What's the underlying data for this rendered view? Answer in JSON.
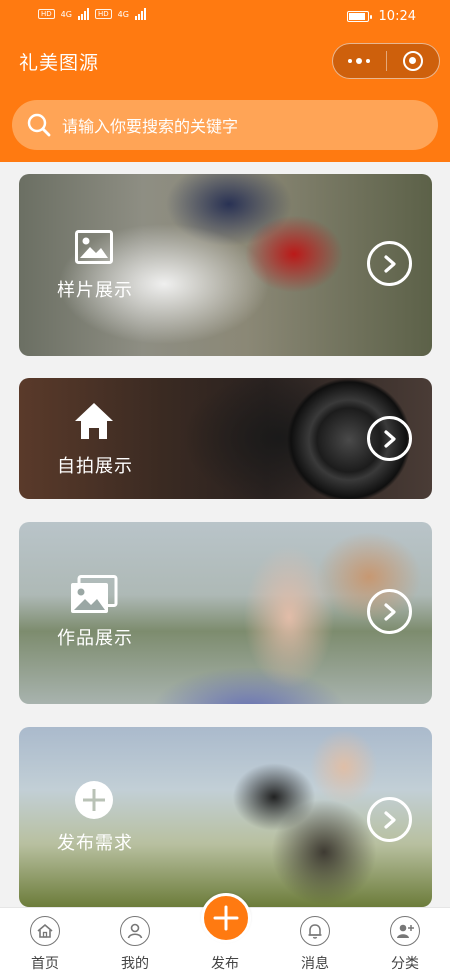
{
  "status_bar": {
    "time": "10:24",
    "sim1_tag": "HD",
    "sim2_tag": "HD",
    "network1": "4G",
    "network2": "4G"
  },
  "header": {
    "title": "礼美图源",
    "search_placeholder": "请输入你要搜索的关键字"
  },
  "cards": [
    {
      "label": "样片展示",
      "icon": "image-icon"
    },
    {
      "label": "自拍展示",
      "icon": "house-icon"
    },
    {
      "label": "作品展示",
      "icon": "gallery-icon"
    },
    {
      "label": "发布需求",
      "icon": "plus-circle-icon"
    }
  ],
  "tabbar": {
    "items": [
      {
        "label": "首页",
        "icon": "home-icon"
      },
      {
        "label": "我的",
        "icon": "user-icon"
      },
      {
        "label": "发布",
        "icon": "plus-icon"
      },
      {
        "label": "消息",
        "icon": "bell-icon"
      },
      {
        "label": "分类",
        "icon": "user-add-icon"
      }
    ]
  },
  "colors": {
    "accent": "#ff7a11",
    "search_bg": "#ffa456",
    "page_bg": "#f2f2f2"
  }
}
